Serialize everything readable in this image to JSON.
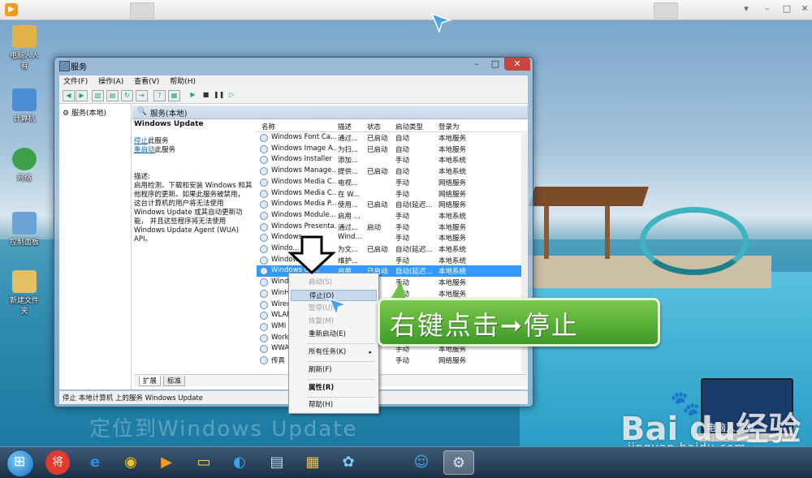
{
  "player": {
    "logo": "▶",
    "min": "▾",
    "restore": "–",
    "max": "□",
    "close": "✕"
  },
  "desktop": {
    "icons": [
      {
        "label": "电脑人人有"
      },
      {
        "label": "计算机"
      },
      {
        "label": "网络"
      },
      {
        "label": "控制面板"
      },
      {
        "label": "新建文件夹"
      }
    ]
  },
  "window": {
    "title": "服务",
    "min": "–",
    "max": "□",
    "close": "✕",
    "menu": [
      "文件(F)",
      "操作(A)",
      "查看(V)",
      "帮助(H)"
    ],
    "tree_root": "服务(本地)",
    "panel_header": "服务(本地)",
    "detail": {
      "service_name": "Windows Update",
      "stop_link": "停止",
      "stop_suffix": "此服务",
      "restart_link": "重启动",
      "restart_suffix": "此服务",
      "desc_label": "描述:",
      "desc_lines": [
        "启用检测、下载和安装 Windows 和其",
        "他程序的更新。如果此服务被禁用，",
        "这台计算机的用户将无法使用",
        "Windows Update 或其自动更新功",
        "能， 并且这些程序将无法使用",
        "Windows Update Agent (WUA) API。"
      ]
    },
    "columns": [
      "名称",
      "描述",
      "状态",
      "启动类型",
      "登录为"
    ],
    "rows": [
      [
        "Windows Font Ca...",
        "通过...",
        "已启动",
        "自动",
        "本地服务"
      ],
      [
        "Windows Image A...",
        "为扫...",
        "已启动",
        "自动",
        "本地服务"
      ],
      [
        "Windows Installer",
        "添加...",
        "",
        "手动",
        "本地系统"
      ],
      [
        "Windows Manage...",
        "提供...",
        "已启动",
        "自动",
        "本地系统"
      ],
      [
        "Windows Media C...",
        "电视...",
        "",
        "手动",
        "网络服务"
      ],
      [
        "Windows Media C...",
        "在 W...",
        "",
        "手动",
        "网络服务"
      ],
      [
        "Windows Media P...",
        "使用...",
        "已启动",
        "自动(延迟...",
        "网络服务"
      ],
      [
        "Windows Module...",
        "启用 ...",
        "",
        "手动",
        "本地系统"
      ],
      [
        "Windows Presenta...",
        "通过...",
        "启动",
        "手动",
        "本地服务"
      ],
      [
        "Windows ...",
        "Wind...",
        "",
        "手动",
        "本地服务"
      ],
      [
        "Windo...",
        "为文...",
        "已启动",
        "自动(延迟...",
        "本地系统"
      ],
      [
        "Windows ...",
        "维护...",
        "",
        "手动",
        "本地系统"
      ],
      [
        "Windows Up...",
        "启用...",
        "已启动",
        "自动(延迟...",
        "本地系统"
      ],
      [
        "Windo...",
        "",
        "",
        "手动",
        "本地服务"
      ],
      [
        "WinHT...",
        "",
        "",
        "手动",
        "本地服务"
      ],
      [
        "Wired...",
        "",
        "",
        "手动",
        "本地系统"
      ],
      [
        "WLAN...",
        "",
        "",
        "手动",
        "本地系统"
      ],
      [
        "WMI P...",
        "",
        "",
        "手动",
        "本地系统"
      ],
      [
        "Works...",
        "",
        "",
        "自动",
        "网络服务"
      ],
      [
        "WWAN...",
        "",
        "",
        "手动",
        "本地服务"
      ],
      [
        "传真",
        "",
        "",
        "手动",
        "网络服务"
      ]
    ],
    "tabs": [
      "扩展",
      "标准"
    ],
    "status": "停止 本地计算机 上的服务 Windows Update"
  },
  "context_menu": {
    "items": [
      {
        "label": "启动(S)",
        "state": "disabled"
      },
      {
        "label": "停止(O)",
        "state": "hover"
      },
      {
        "label": "暂停(U)",
        "state": "disabled"
      },
      {
        "label": "恢复(M)",
        "state": "disabled"
      },
      {
        "label": "重新启动(E)",
        "state": "normal"
      },
      {
        "label": "所有任务(K)",
        "state": "normal",
        "submenu": "▸"
      },
      {
        "label": "刷新(F)",
        "state": "normal"
      },
      {
        "label": "属性(R)",
        "state": "bold"
      },
      {
        "label": "帮助(H)",
        "state": "normal"
      }
    ]
  },
  "annotation": {
    "callout": "右键点击➞停止",
    "overlay": "定位到Windows Update"
  },
  "watermark": {
    "brand": "Bai  du经验",
    "url": "jingyan.baidu.com",
    "laptop_text": "电脑人人有",
    "paw": "🐾"
  },
  "taskbar": {
    "apps": [
      {
        "icon": "将"
      },
      {
        "icon": "e"
      },
      {
        "icon": "◉"
      },
      {
        "icon": "▶"
      },
      {
        "icon": "▭"
      },
      {
        "icon": "◐"
      },
      {
        "icon": "▤"
      },
      {
        "icon": "▦"
      },
      {
        "icon": "✿"
      },
      {
        "icon": "☺"
      },
      {
        "icon": "⚙"
      }
    ]
  },
  "colors": {
    "accent": "#3399ff",
    "callout_green": "#5ab536"
  }
}
